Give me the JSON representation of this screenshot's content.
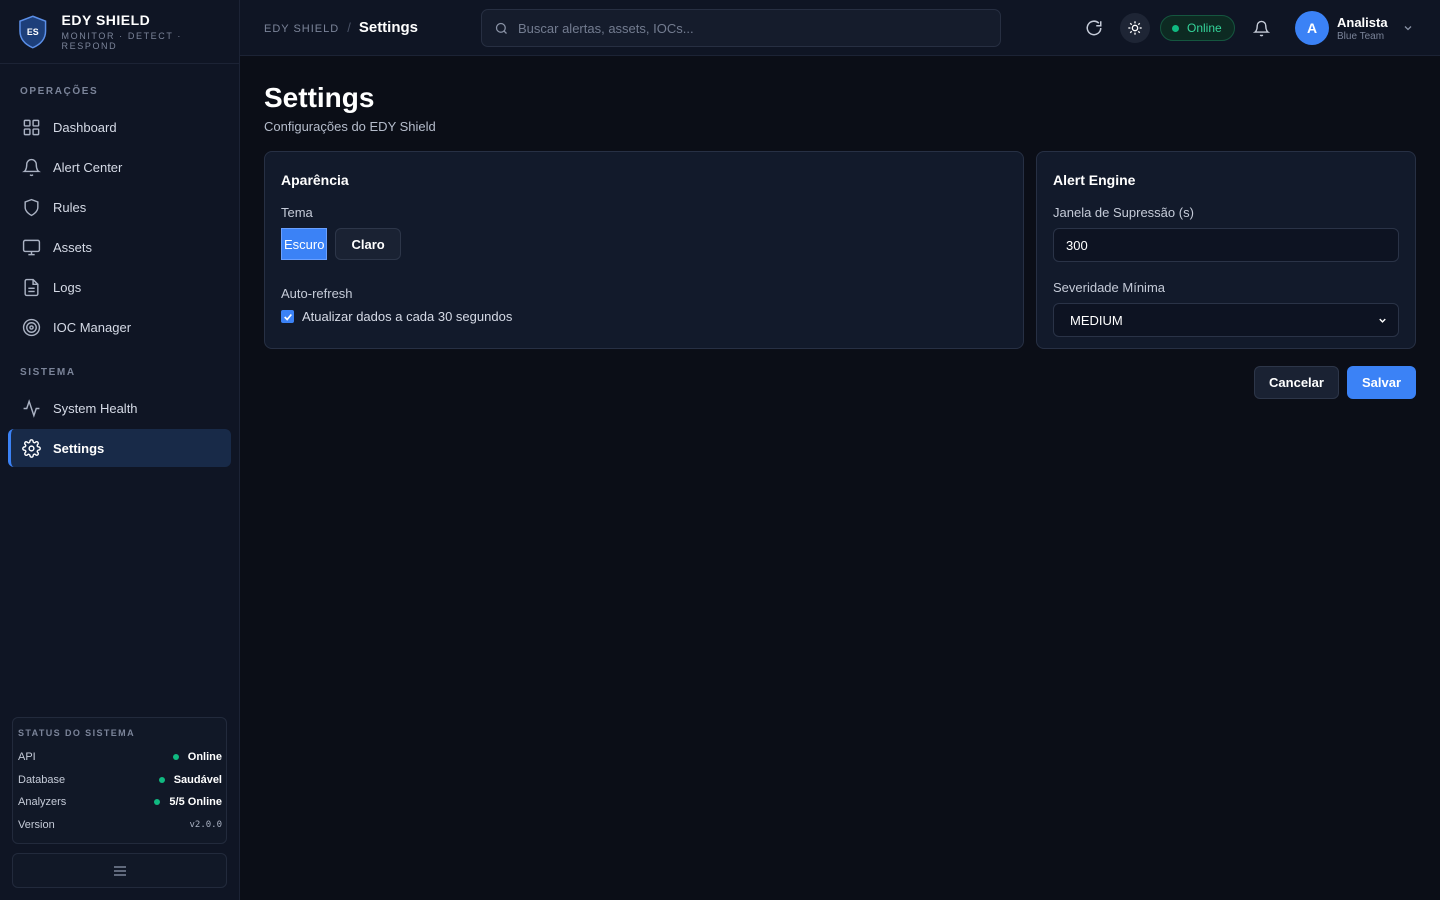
{
  "brand": {
    "name": "EDY SHIELD",
    "tagline": "MONITOR · DETECT · RESPOND",
    "logo_text": "ES"
  },
  "sidebar": {
    "section_operations": "OPERAÇÕES",
    "operations": [
      {
        "label": "Dashboard",
        "icon": "grid-icon"
      },
      {
        "label": "Alert Center",
        "icon": "bell-icon"
      },
      {
        "label": "Rules",
        "icon": "shield-icon"
      },
      {
        "label": "Assets",
        "icon": "monitor-icon"
      },
      {
        "label": "Logs",
        "icon": "file-icon"
      },
      {
        "label": "IOC Manager",
        "icon": "target-icon"
      }
    ],
    "section_system": "SISTEMA",
    "system": [
      {
        "label": "System Health",
        "icon": "activity-icon"
      },
      {
        "label": "Settings",
        "icon": "gear-icon",
        "active": true
      }
    ],
    "status": {
      "title": "STATUS DO SISTEMA",
      "rows": [
        {
          "label": "API",
          "value": "Online",
          "dot": true
        },
        {
          "label": "Database",
          "value": "Saudável",
          "dot": true
        },
        {
          "label": "Analyzers",
          "value": "5/5 Online",
          "dot": true
        },
        {
          "label": "Version",
          "value": "v2.0.0",
          "dot": false
        }
      ]
    }
  },
  "topbar": {
    "breadcrumb_root": "EDY SHIELD",
    "breadcrumb_separator": "/",
    "breadcrumb_current": "Settings",
    "search_placeholder": "Buscar alertas, assets, IOCs...",
    "status_pill": "Online",
    "user_initial": "A",
    "user_name": "Analista",
    "user_role": "Blue Team"
  },
  "page": {
    "title": "Settings",
    "subtitle": "Configurações do EDY Shield"
  },
  "appearance": {
    "title": "Aparência",
    "theme_label": "Tema",
    "theme_dark": "Escuro",
    "theme_light": "Claro",
    "autorefresh_label": "Auto-refresh",
    "autorefresh_text": "Atualizar dados a cada 30 segundos",
    "autorefresh_checked": true
  },
  "alert_engine": {
    "title": "Alert Engine",
    "suppression_label": "Janela de Supressão (s)",
    "suppression_value": "300",
    "severity_label": "Severidade Mínima",
    "severity_value": "MEDIUM"
  },
  "actions": {
    "cancel": "Cancelar",
    "save": "Salvar"
  },
  "colors": {
    "accent": "#3b82f6",
    "online": "#10b981",
    "background": "#0b0e17",
    "sidebar": "#0f1524"
  }
}
